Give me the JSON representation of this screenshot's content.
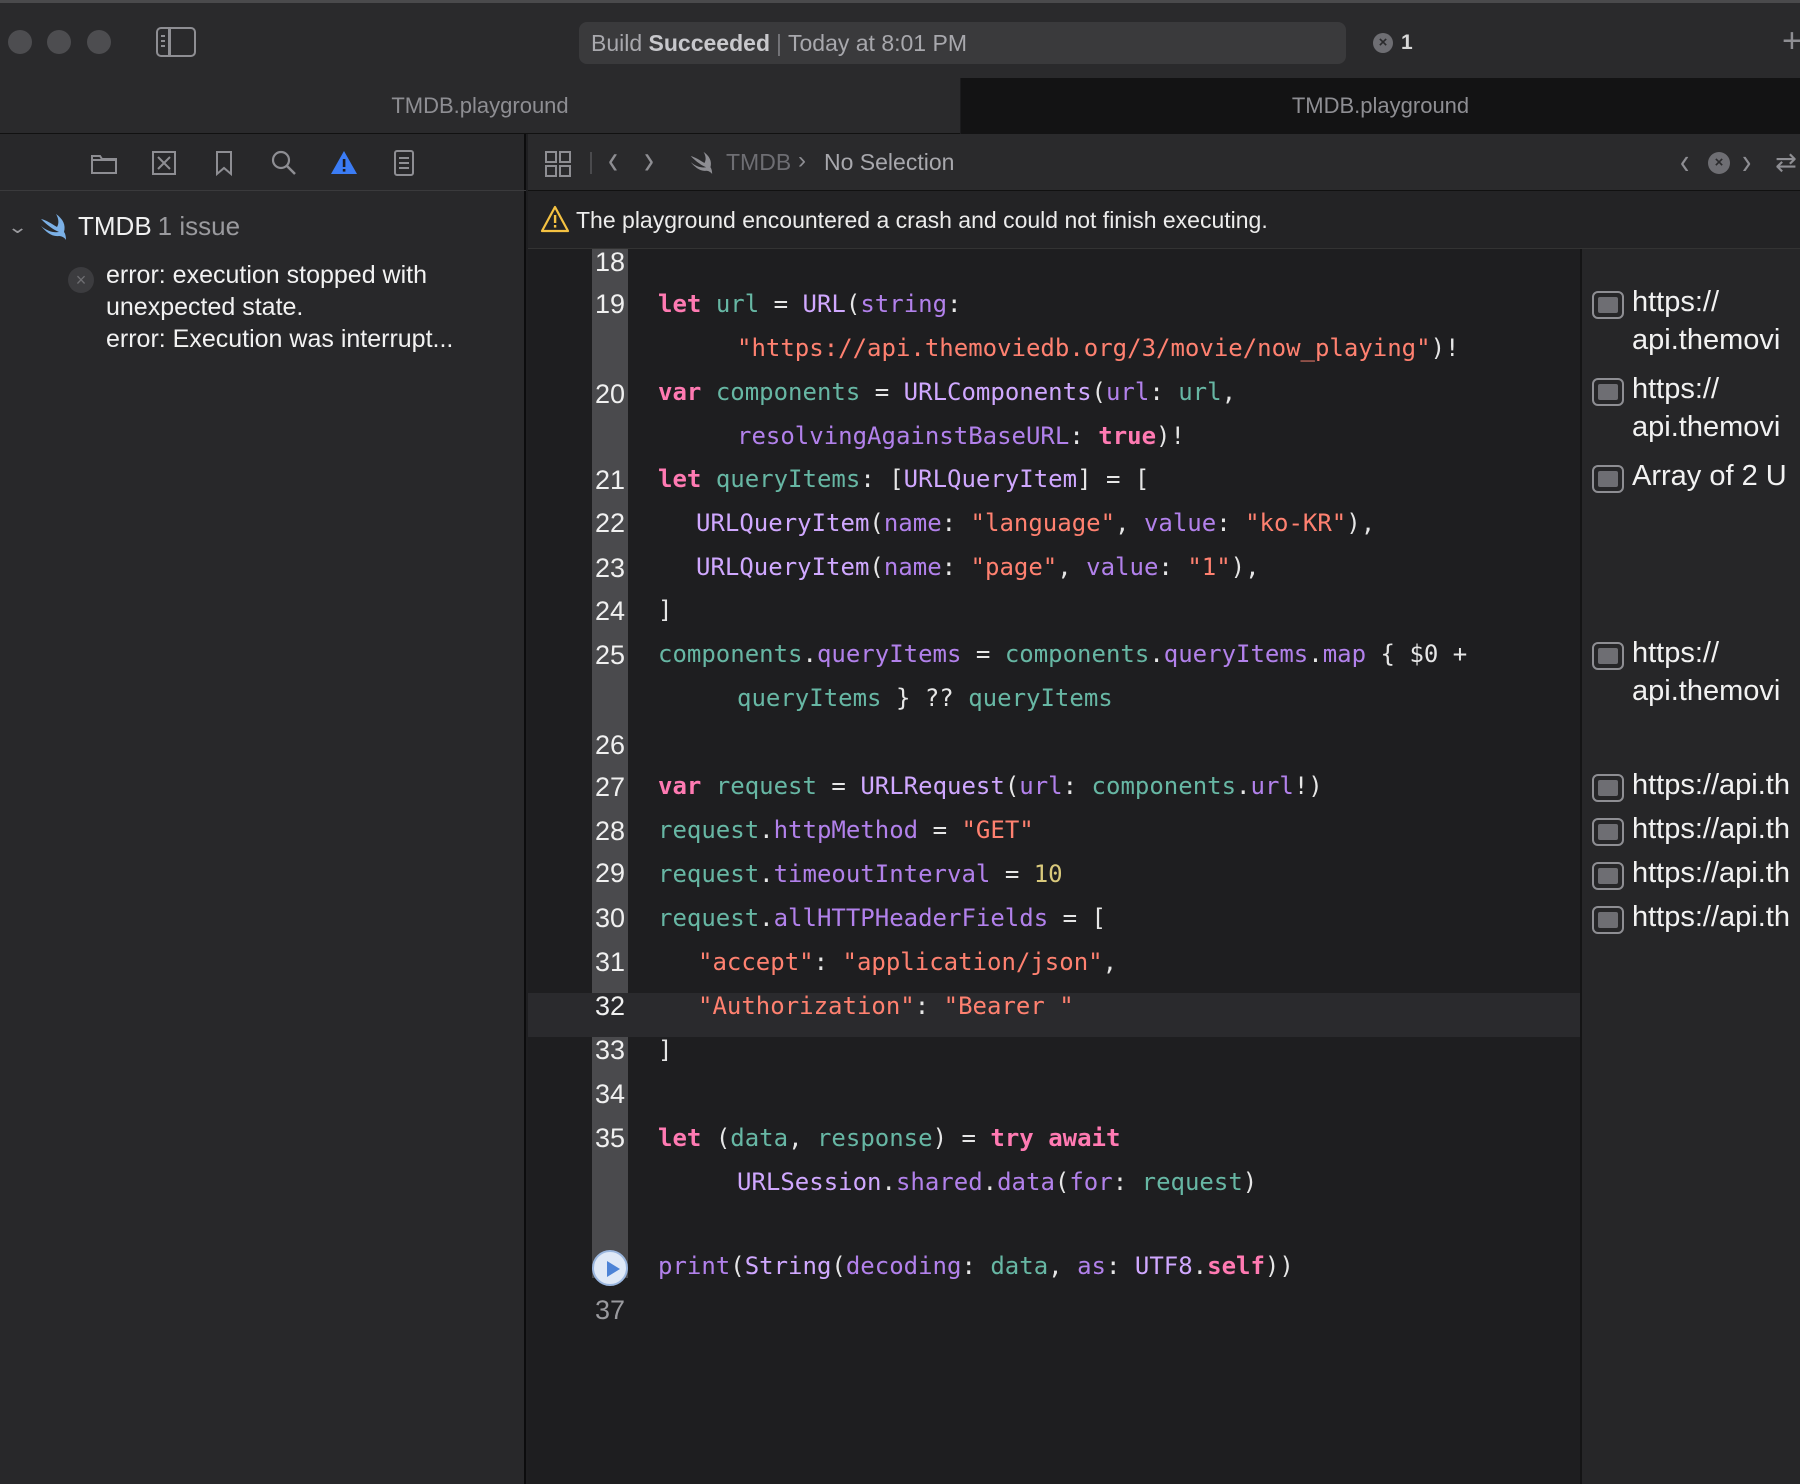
{
  "window": {
    "activity": {
      "prefix": "Build",
      "status": "Succeeded",
      "time": "Today at 8:01 PM"
    },
    "issue_count": "1",
    "tabs": [
      {
        "label": "TMDB.playground"
      },
      {
        "label": "TMDB.playground"
      }
    ]
  },
  "navigator": {
    "project": {
      "name": "TMDB",
      "issues": "1 issue"
    },
    "error_lines": [
      "error: execution stopped with",
      "unexpected state.",
      "error: Execution was interrupt..."
    ]
  },
  "jumpbar": {
    "crumbs": [
      "TMDB",
      "No Selection"
    ]
  },
  "warning": {
    "text": "The playground encountered a crash and could not finish executing."
  },
  "code": {
    "line_numbers": [
      "18",
      "19",
      "20",
      "21",
      "22",
      "23",
      "24",
      "25",
      "26",
      "27",
      "28",
      "29",
      "30",
      "31",
      "32",
      "33",
      "34",
      "35",
      "37"
    ],
    "tokens": {
      "kw_let": "let",
      "kw_var": "var",
      "kw_true": "true",
      "kw_try": "try",
      "kw_await": "await",
      "kw_self": "self",
      "url": "url",
      "components": "components",
      "queryItems": "queryItems",
      "request": "request",
      "data": "data",
      "response": "response",
      "URL": "URL",
      "URLComponents": "URLComponents",
      "URLQueryItem": "URLQueryItem",
      "URLRequest": "URLRequest",
      "URLSession": "URLSession",
      "String": "String",
      "UTF8": "UTF8",
      "print": "print",
      "p_string": "string",
      "p_url": "url",
      "p_resolving": "resolvingAgainstBaseURL",
      "p_name": "name",
      "p_value": "value",
      "p_map": "map",
      "p_httpMethod": "httpMethod",
      "p_timeout": "timeoutInterval",
      "p_headers": "allHTTPHeaderFields",
      "p_shared": "shared",
      "p_data": "data",
      "p_for": "for",
      "p_decoding": "decoding",
      "p_as": "as",
      "s_endpoint": "\"https://api.themoviedb.org/3/movie/now_playing\"",
      "s_language": "\"language\"",
      "s_ko": "\"ko-KR\"",
      "s_page": "\"page\"",
      "s_one": "\"1\"",
      "s_get": "\"GET\"",
      "s_accept": "\"accept\"",
      "s_json": "\"application/json\"",
      "s_auth": "\"Authorization\"",
      "s_bearer": "\"Bearer \"",
      "n_ten": "10",
      "dollar0": "$0"
    }
  },
  "results": [
    {
      "lines": [
        "https://",
        "api.themovi"
      ]
    },
    {
      "lines": [
        "https://",
        "api.themovi"
      ]
    },
    {
      "lines": [
        "Array of 2 U"
      ]
    },
    {
      "lines": [
        "https://",
        "api.themovi"
      ]
    },
    {
      "lines": [
        "https://api.th"
      ]
    },
    {
      "lines": [
        "https://api.th"
      ]
    },
    {
      "lines": [
        "https://api.th"
      ]
    },
    {
      "lines": [
        "https://api.th"
      ]
    }
  ]
}
